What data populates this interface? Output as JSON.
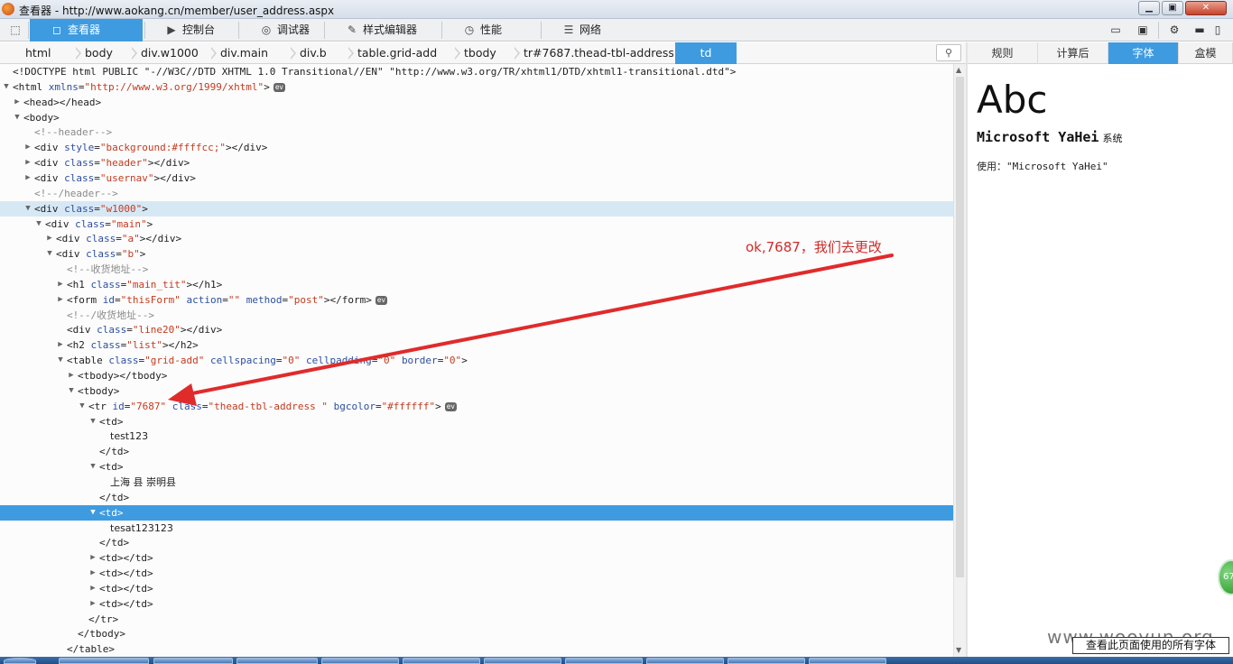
{
  "window": {
    "title": "查看器 - http://www.aokang.cn/member/user_address.aspx",
    "buttons": [
      "▁",
      "▣",
      "✕"
    ]
  },
  "toolbar": {
    "tools": [
      {
        "name": "inspector",
        "label": "查看器",
        "icon": "inspector-icon",
        "glyph": "◻",
        "active": true
      },
      {
        "name": "console",
        "label": "控制台",
        "icon": "console-icon",
        "glyph": "▶",
        "active": false
      },
      {
        "name": "debugger",
        "label": "调试器",
        "icon": "debugger-icon",
        "glyph": "◎",
        "active": false
      },
      {
        "name": "style-editor",
        "label": "样式编辑器",
        "icon": "style-editor-icon",
        "glyph": "✎",
        "active": false
      },
      {
        "name": "performance",
        "label": "性能",
        "icon": "performance-icon",
        "glyph": "◷",
        "active": false
      },
      {
        "name": "network",
        "label": "网络",
        "icon": "network-icon",
        "glyph": "☰",
        "active": false
      }
    ]
  },
  "breadcrumbs": [
    "html",
    "body",
    "div.w1000",
    "div.main",
    "div.b",
    "table.grid-add",
    "tbody",
    "tr#7687.thead-tbl-address.",
    "td"
  ],
  "side_panel": {
    "tabs": [
      "规则",
      "计算后",
      "字体",
      "盒模"
    ],
    "active_tab": "字体",
    "preview_text": "Abc",
    "font_name": "Microsoft YaHei",
    "font_source": "系统",
    "usage_label": "使用：",
    "usage_value": "\"Microsoft YaHei\"",
    "all_fonts_button": "查看此页面使用的所有字体"
  },
  "annotation": {
    "text": "ok,7687，我们去更改",
    "color": "#d32a2a"
  },
  "watermark": "www.wooyun.org",
  "badge": "67",
  "colors": {
    "accent": "#3e9be0",
    "attr_name": "#2d4f9e",
    "attr_value": "#c33b20",
    "comment": "#8a8a8a"
  },
  "tree": [
    {
      "d": 0,
      "tw": "",
      "parts": [
        [
          "t",
          "<!DOCTYPE html PUBLIC \"-//W3C//DTD XHTML 1.0 Transitional//EN\" \"http://www.w3.org/TR/xhtml1/DTD/xhtml1-transitional.dtd\">"
        ]
      ]
    },
    {
      "d": 0,
      "tw": "open",
      "ev": true,
      "parts": [
        [
          "t",
          "<html "
        ],
        [
          "a",
          "xmlns"
        ],
        [
          "t",
          "="
        ],
        [
          "v",
          "\"http://www.w3.org/1999/xhtml\""
        ],
        [
          "t",
          ">"
        ]
      ]
    },
    {
      "d": 1,
      "tw": "closed",
      "parts": [
        [
          "t",
          "<head></head>"
        ]
      ]
    },
    {
      "d": 1,
      "tw": "open",
      "parts": [
        [
          "t",
          "<body>"
        ]
      ]
    },
    {
      "d": 2,
      "tw": "",
      "parts": [
        [
          "c",
          "<!--header-->"
        ]
      ]
    },
    {
      "d": 2,
      "tw": "closed",
      "parts": [
        [
          "t",
          "<div "
        ],
        [
          "a",
          "style"
        ],
        [
          "t",
          "="
        ],
        [
          "v",
          "\"background:#ffffcc;\""
        ],
        [
          "t",
          "></div>"
        ]
      ]
    },
    {
      "d": 2,
      "tw": "closed",
      "parts": [
        [
          "t",
          "<div "
        ],
        [
          "a",
          "class"
        ],
        [
          "t",
          "="
        ],
        [
          "v",
          "\"header\""
        ],
        [
          "t",
          "></div>"
        ]
      ]
    },
    {
      "d": 2,
      "tw": "closed",
      "parts": [
        [
          "t",
          "<div "
        ],
        [
          "a",
          "class"
        ],
        [
          "t",
          "="
        ],
        [
          "v",
          "\"usernav\""
        ],
        [
          "t",
          "></div>"
        ]
      ]
    },
    {
      "d": 2,
      "tw": "",
      "parts": [
        [
          "c",
          "<!--/header-->"
        ]
      ]
    },
    {
      "d": 2,
      "tw": "open",
      "hl": "light",
      "parts": [
        [
          "t",
          "<div "
        ],
        [
          "a",
          "class"
        ],
        [
          "t",
          "="
        ],
        [
          "v",
          "\"w1000\""
        ],
        [
          "t",
          ">"
        ]
      ]
    },
    {
      "d": 3,
      "tw": "open",
      "parts": [
        [
          "t",
          "<div "
        ],
        [
          "a",
          "class"
        ],
        [
          "t",
          "="
        ],
        [
          "v",
          "\"main\""
        ],
        [
          "t",
          ">"
        ]
      ]
    },
    {
      "d": 4,
      "tw": "closed",
      "parts": [
        [
          "t",
          "<div "
        ],
        [
          "a",
          "class"
        ],
        [
          "t",
          "="
        ],
        [
          "v",
          "\"a\""
        ],
        [
          "t",
          "></div>"
        ]
      ]
    },
    {
      "d": 4,
      "tw": "open",
      "parts": [
        [
          "t",
          "<div "
        ],
        [
          "a",
          "class"
        ],
        [
          "t",
          "="
        ],
        [
          "v",
          "\"b\""
        ],
        [
          "t",
          ">"
        ]
      ]
    },
    {
      "d": 5,
      "tw": "",
      "parts": [
        [
          "c",
          "<!--收货地址-->"
        ]
      ]
    },
    {
      "d": 5,
      "tw": "closed",
      "parts": [
        [
          "t",
          "<h1 "
        ],
        [
          "a",
          "class"
        ],
        [
          "t",
          "="
        ],
        [
          "v",
          "\"main_tit\""
        ],
        [
          "t",
          "></h1>"
        ]
      ]
    },
    {
      "d": 5,
      "tw": "closed",
      "ev": true,
      "parts": [
        [
          "t",
          "<form "
        ],
        [
          "a",
          "id"
        ],
        [
          "t",
          "="
        ],
        [
          "v",
          "\"thisForm\""
        ],
        [
          "t",
          " "
        ],
        [
          "a",
          "action"
        ],
        [
          "t",
          "="
        ],
        [
          "v",
          "\"\""
        ],
        [
          "t",
          " "
        ],
        [
          "a",
          "method"
        ],
        [
          "t",
          "="
        ],
        [
          "v",
          "\"post\""
        ],
        [
          "t",
          "></form>"
        ]
      ]
    },
    {
      "d": 5,
      "tw": "",
      "parts": [
        [
          "c",
          "<!--/收货地址-->"
        ]
      ]
    },
    {
      "d": 5,
      "tw": "",
      "parts": [
        [
          "t",
          "<div "
        ],
        [
          "a",
          "class"
        ],
        [
          "t",
          "="
        ],
        [
          "v",
          "\"line20\""
        ],
        [
          "t",
          "></div>"
        ]
      ]
    },
    {
      "d": 5,
      "tw": "closed",
      "parts": [
        [
          "t",
          "<h2 "
        ],
        [
          "a",
          "class"
        ],
        [
          "t",
          "="
        ],
        [
          "v",
          "\"list\""
        ],
        [
          "t",
          "></h2>"
        ]
      ]
    },
    {
      "d": 5,
      "tw": "open",
      "parts": [
        [
          "t",
          "<table "
        ],
        [
          "a",
          "class"
        ],
        [
          "t",
          "="
        ],
        [
          "v",
          "\"grid-add\""
        ],
        [
          "t",
          " "
        ],
        [
          "a",
          "cellspacing"
        ],
        [
          "t",
          "="
        ],
        [
          "v",
          "\"0\""
        ],
        [
          "t",
          " "
        ],
        [
          "a",
          "cellpadding"
        ],
        [
          "t",
          "="
        ],
        [
          "v",
          "\"0\""
        ],
        [
          "t",
          " "
        ],
        [
          "a",
          "border"
        ],
        [
          "t",
          "="
        ],
        [
          "v",
          "\"0\""
        ],
        [
          "t",
          ">"
        ]
      ]
    },
    {
      "d": 6,
      "tw": "closed",
      "parts": [
        [
          "t",
          "<tbody></tbody>"
        ]
      ]
    },
    {
      "d": 6,
      "tw": "open",
      "parts": [
        [
          "t",
          "<tbody>"
        ]
      ]
    },
    {
      "d": 7,
      "tw": "open",
      "ev": true,
      "parts": [
        [
          "t",
          "<tr "
        ],
        [
          "a",
          "id"
        ],
        [
          "t",
          "="
        ],
        [
          "v",
          "\"7687\""
        ],
        [
          "t",
          " "
        ],
        [
          "a",
          "class"
        ],
        [
          "t",
          "="
        ],
        [
          "v",
          "\"thead-tbl-address \""
        ],
        [
          "t",
          " "
        ],
        [
          "a",
          "bgcolor"
        ],
        [
          "t",
          "="
        ],
        [
          "v",
          "\"#ffffff\""
        ],
        [
          "t",
          ">"
        ]
      ]
    },
    {
      "d": 8,
      "tw": "open",
      "parts": [
        [
          "t",
          "<td>"
        ]
      ]
    },
    {
      "d": 9,
      "tw": "",
      "parts": [
        [
          "x",
          "test123"
        ]
      ]
    },
    {
      "d": 8,
      "tw": "",
      "parts": [
        [
          "t",
          "</td>"
        ]
      ]
    },
    {
      "d": 8,
      "tw": "open",
      "parts": [
        [
          "t",
          "<td>"
        ]
      ]
    },
    {
      "d": 9,
      "tw": "",
      "parts": [
        [
          "x",
          "上海 县 崇明县"
        ]
      ]
    },
    {
      "d": 8,
      "tw": "",
      "parts": [
        [
          "t",
          "</td>"
        ]
      ]
    },
    {
      "d": 8,
      "tw": "open",
      "hl": "sel",
      "parts": [
        [
          "t",
          "<td>"
        ]
      ]
    },
    {
      "d": 9,
      "tw": "",
      "parts": [
        [
          "x",
          "tesat123123"
        ]
      ]
    },
    {
      "d": 8,
      "tw": "",
      "parts": [
        [
          "t",
          "</td>"
        ]
      ]
    },
    {
      "d": 8,
      "tw": "closed",
      "parts": [
        [
          "t",
          "<td></td>"
        ]
      ]
    },
    {
      "d": 8,
      "tw": "closed",
      "parts": [
        [
          "t",
          "<td></td>"
        ]
      ]
    },
    {
      "d": 8,
      "tw": "closed",
      "parts": [
        [
          "t",
          "<td></td>"
        ]
      ]
    },
    {
      "d": 8,
      "tw": "closed",
      "parts": [
        [
          "t",
          "<td></td>"
        ]
      ]
    },
    {
      "d": 7,
      "tw": "",
      "parts": [
        [
          "t",
          "</tr>"
        ]
      ]
    },
    {
      "d": 6,
      "tw": "",
      "parts": [
        [
          "t",
          "</tbody>"
        ]
      ]
    },
    {
      "d": 5,
      "tw": "",
      "parts": [
        [
          "t",
          "</table>"
        ]
      ]
    }
  ]
}
